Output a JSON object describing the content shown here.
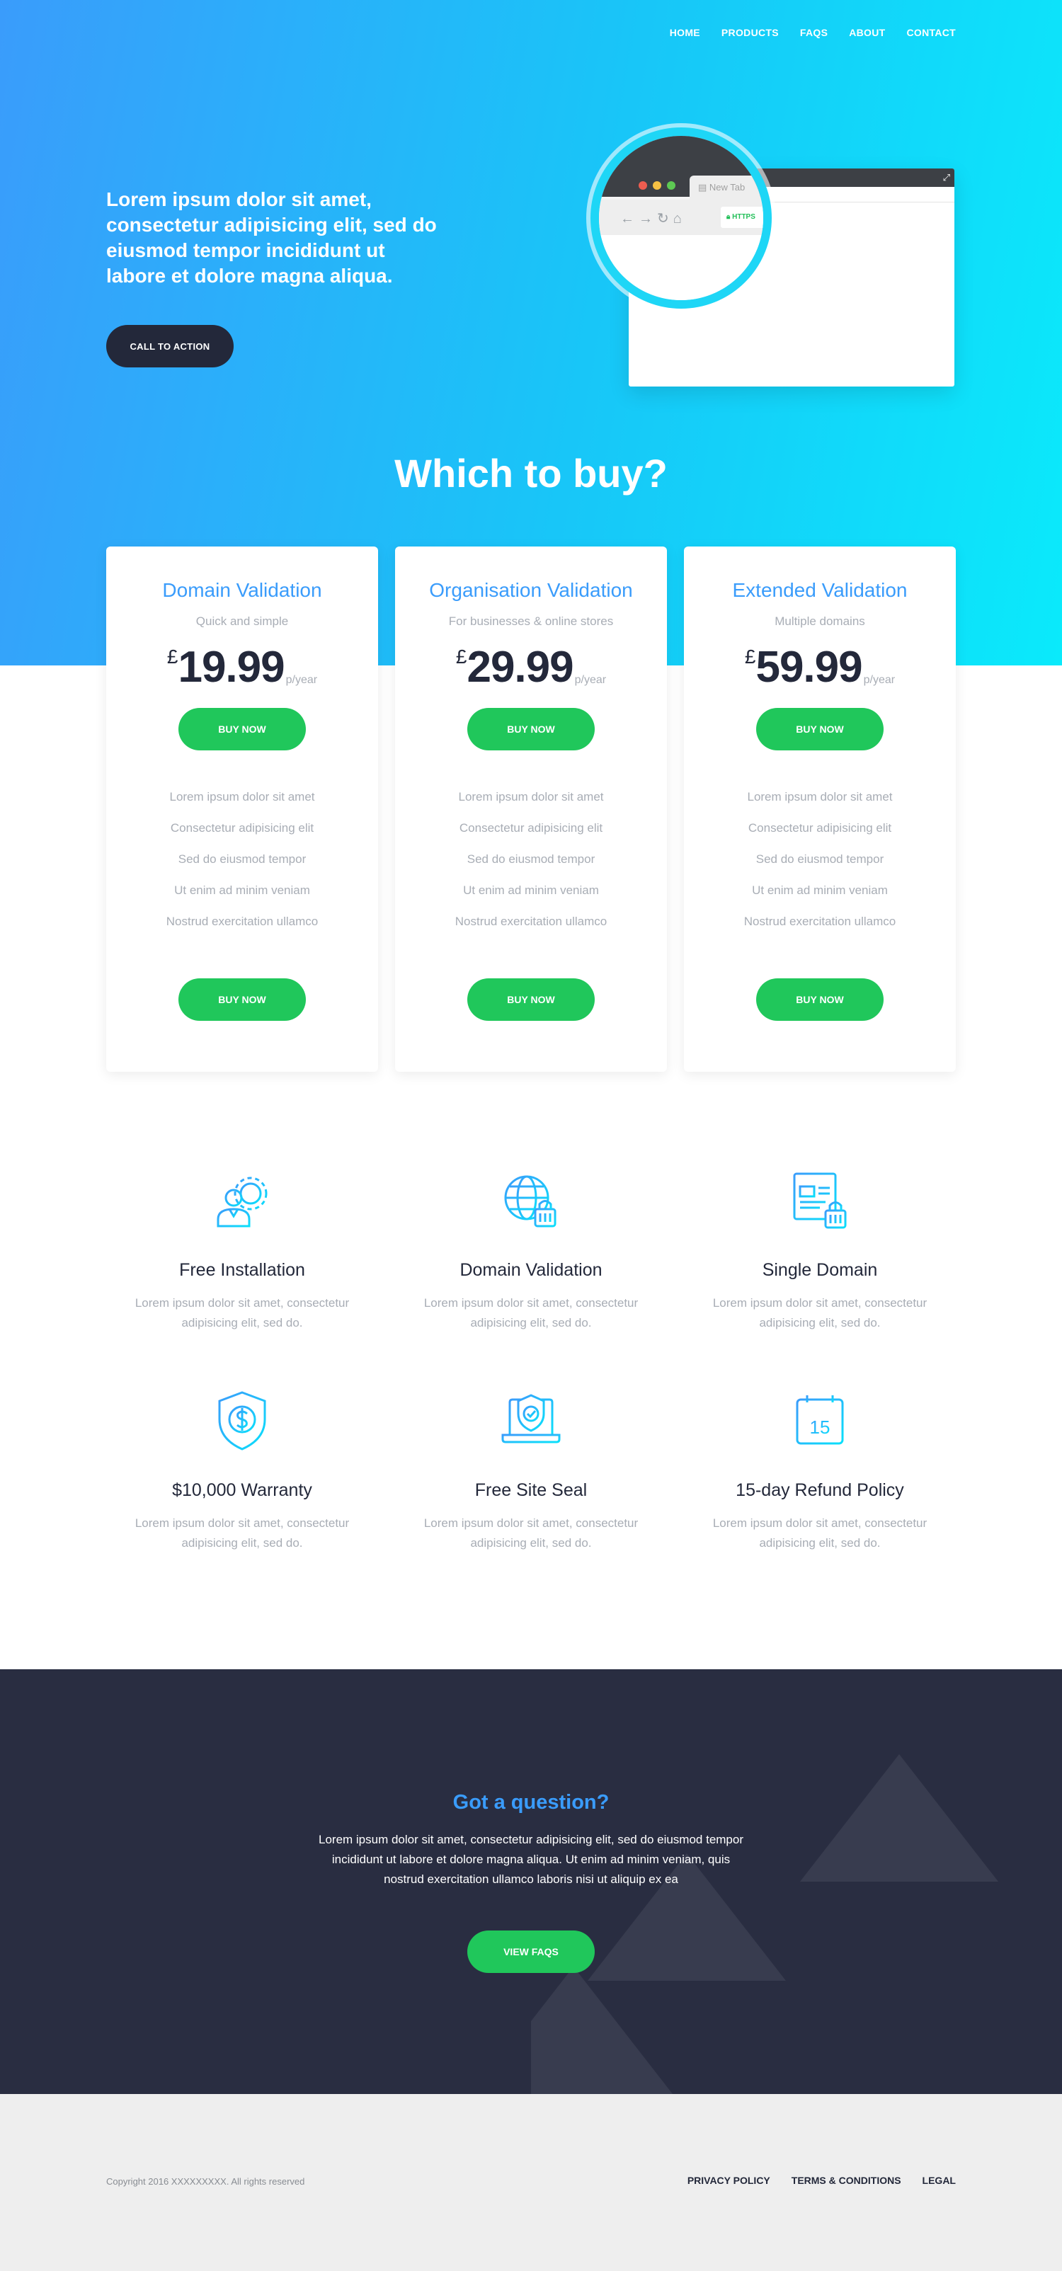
{
  "nav": {
    "items": [
      "HOME",
      "PRODUCTS",
      "FAQS",
      "ABOUT",
      "CONTACT"
    ]
  },
  "hero": {
    "headline": "Lorem ipsum dolor sit amet, consectetur adipisicing elit, sed do eiusmod tempor incididunt ut labore et dolore magna aliqua.",
    "cta_label": "CALL TO ACTION",
    "browser_tab": "New Tab",
    "https_label": "HTTPS"
  },
  "pricing": {
    "title": "Which to buy?",
    "currency": "£",
    "period": "p/year",
    "buy_label": "BUY NOW",
    "plans": [
      {
        "name": "Domain Validation",
        "subtitle": "Quick and simple",
        "price": "19.99"
      },
      {
        "name": "Organisation Validation",
        "subtitle": "For businesses & online stores",
        "price": "29.99"
      },
      {
        "name": "Extended Validation",
        "subtitle": "Multiple domains",
        "price": "59.99"
      }
    ],
    "features": [
      "Lorem ipsum dolor sit amet",
      "Consectetur adipisicing elit",
      "Sed do eiusmod tempor",
      "Ut enim ad minim veniam",
      "Nostrud exercitation ullamco"
    ]
  },
  "benefits": {
    "description": "Lorem ipsum dolor sit amet, consectetur adipisicing elit, sed do.",
    "items": [
      {
        "title": "Free Installation",
        "icon": "installer-gear-icon"
      },
      {
        "title": "Domain Validation",
        "icon": "globe-lock-icon"
      },
      {
        "title": "Single Domain",
        "icon": "webpage-lock-icon"
      },
      {
        "title": "$10,000 Warranty",
        "icon": "shield-dollar-icon"
      },
      {
        "title": "Free Site Seal",
        "icon": "laptop-shield-icon"
      },
      {
        "title": "15-day Refund Policy",
        "icon": "calendar-15-icon",
        "icon_text": "15"
      }
    ]
  },
  "question": {
    "title": "Got a question?",
    "body": "Lorem ipsum dolor sit amet, consectetur adipisicing elit, sed do eiusmod tempor incididunt ut labore et dolore magna aliqua. Ut enim ad minim veniam, quis nostrud exercitation ullamco laboris nisi ut aliquip ex ea",
    "button": "VIEW FAQS"
  },
  "footer": {
    "copyright": "Copyright 2016 XXXXXXXXX. All rights reserved",
    "links": [
      "PRIVACY POLICY",
      "TERMS & CONDITIONS",
      "LEGAL"
    ]
  },
  "colors": {
    "accent_blue": "#3a9cfb",
    "cyan": "#0aeafb",
    "green": "#20c75b",
    "dark": "#23283a"
  }
}
